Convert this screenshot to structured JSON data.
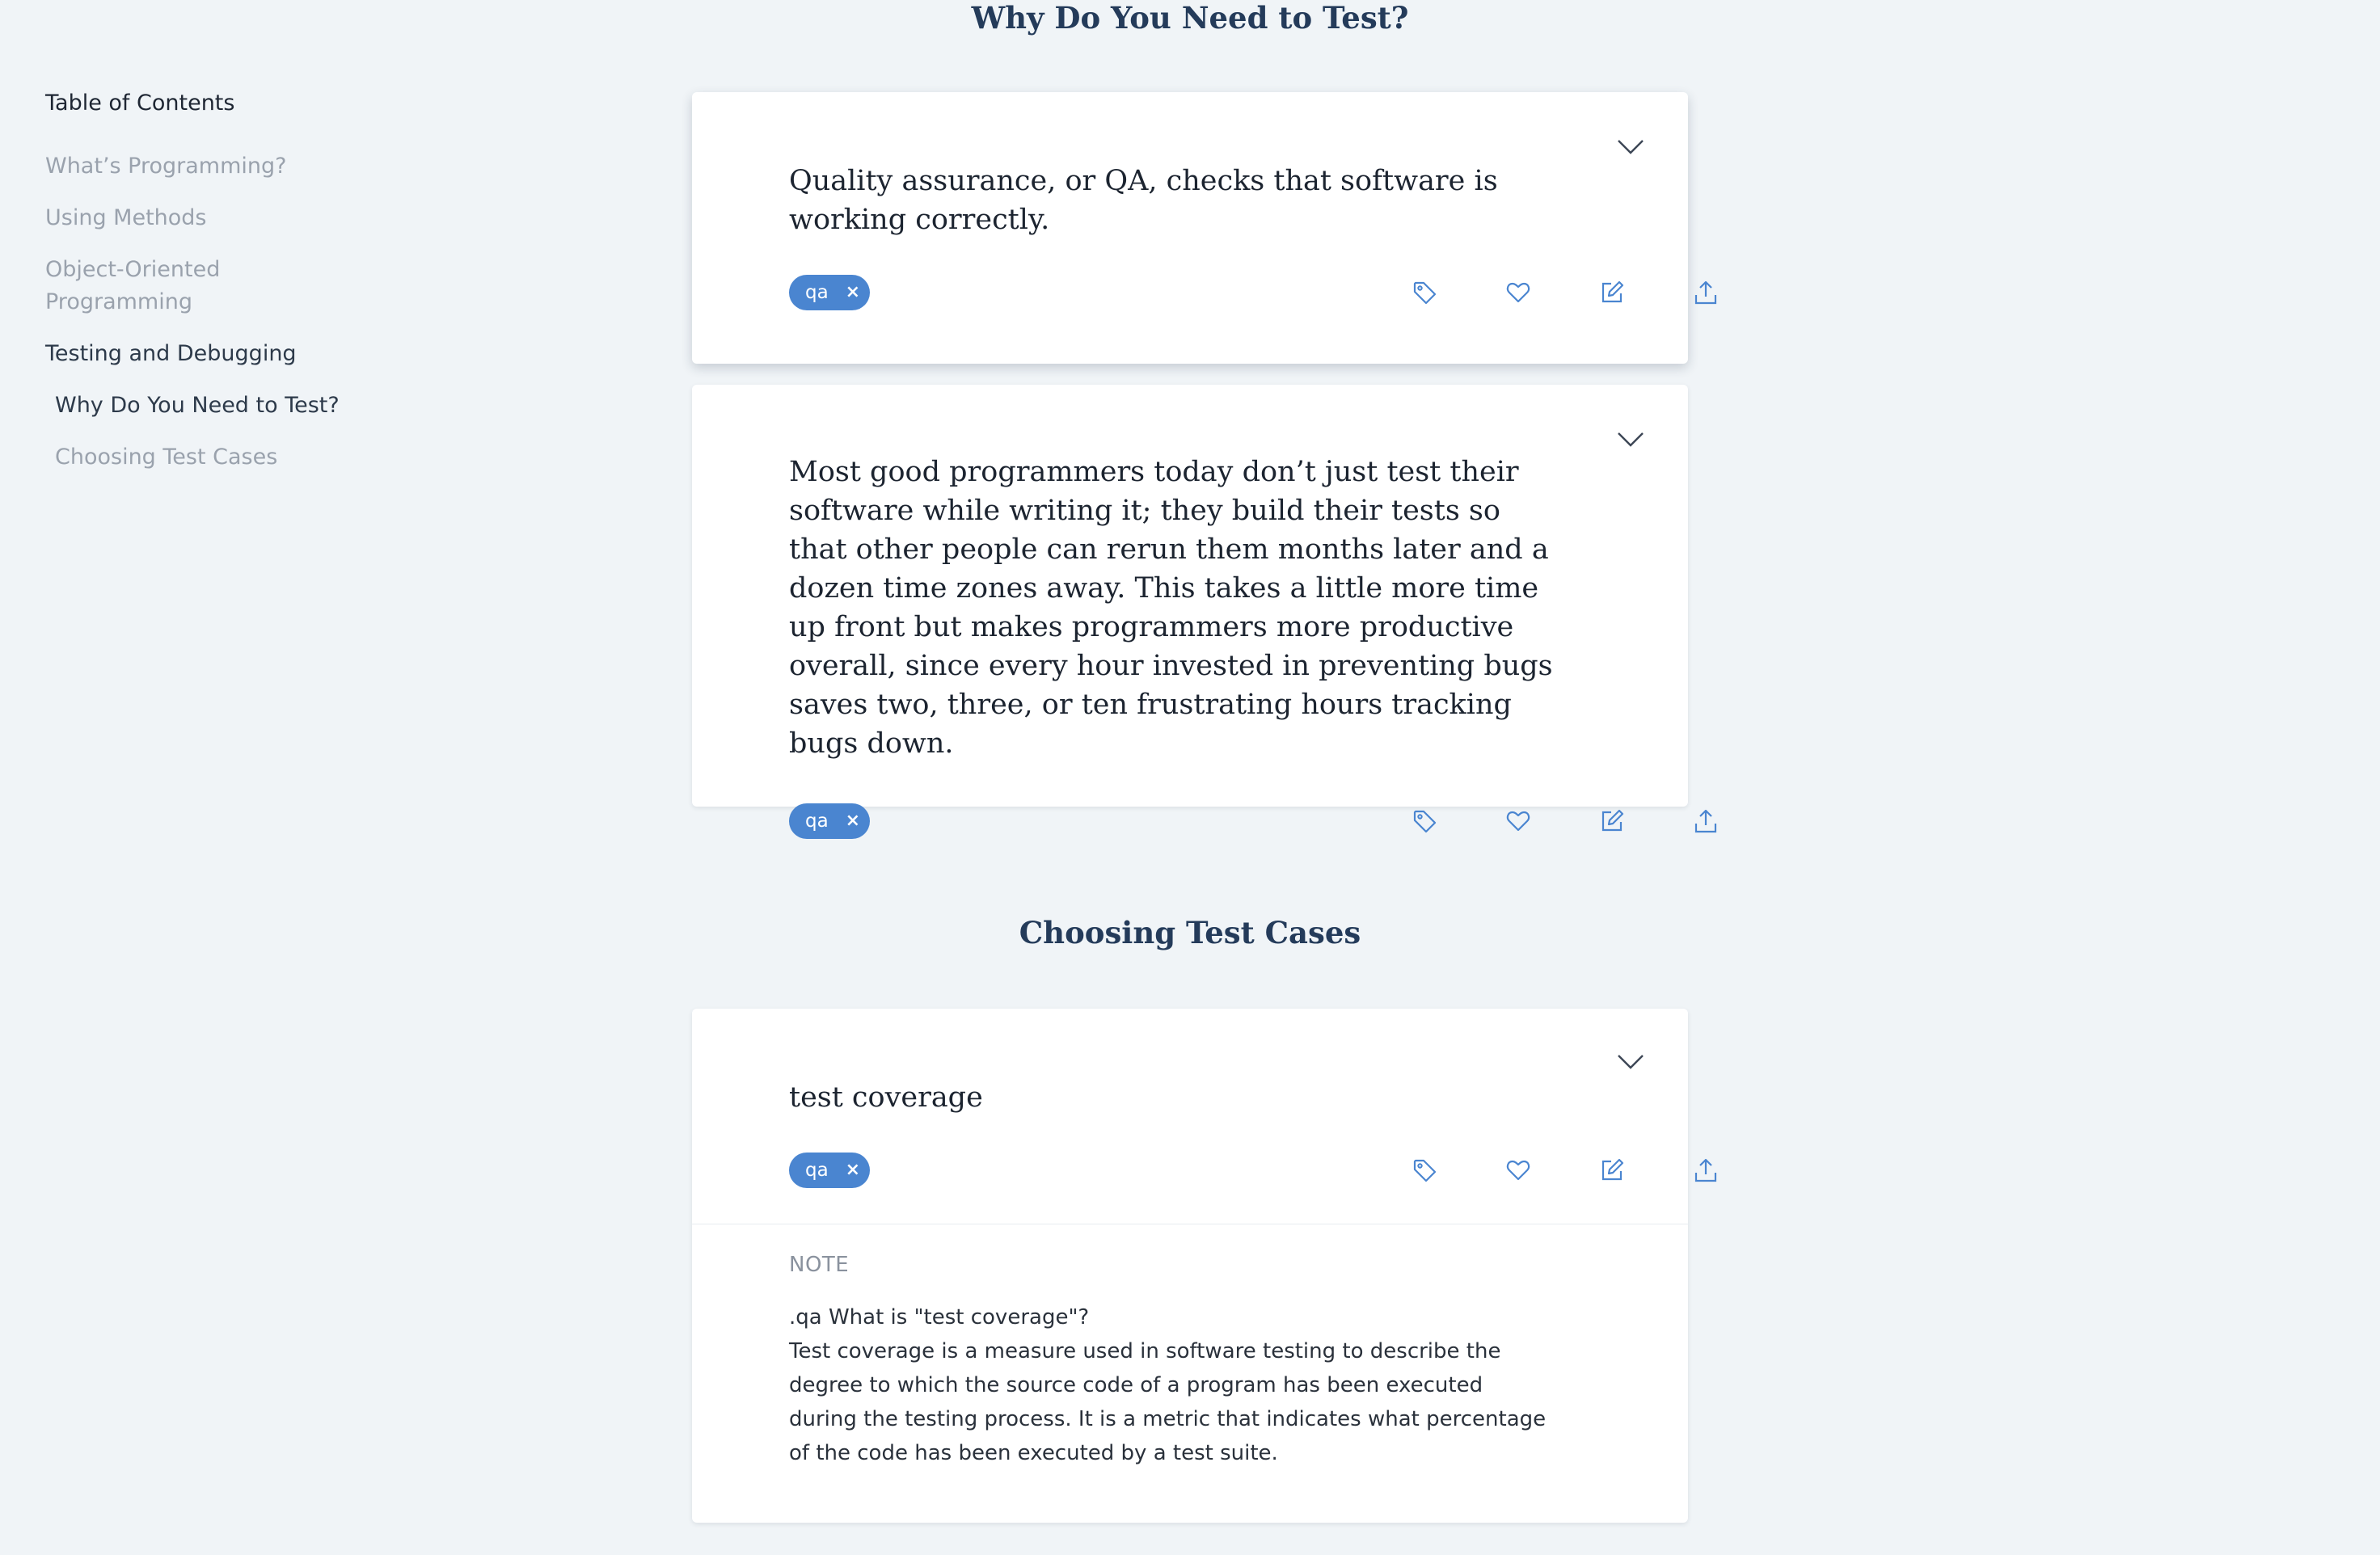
{
  "toc": {
    "title": "Table of Contents",
    "items": [
      {
        "label": "What’s Programming?"
      },
      {
        "label": "Using Methods"
      },
      {
        "label": "Object-Oriented Programming"
      },
      {
        "label": "Testing and Debugging"
      },
      {
        "label": "Why Do You Need to Test?"
      },
      {
        "label": "Choosing Test Cases"
      }
    ]
  },
  "sections": [
    {
      "heading": "Why Do You Need to Test?",
      "cards": [
        {
          "text": "Quality assurance, or QA, checks that software is working correctly.",
          "tag": "qa",
          "tag_remove": "×"
        },
        {
          "text": "Most good programmers today don’t just test their software while writing it; they build their tests so that other people can rerun them months later and a dozen time zones away. This takes a little more time up front but makes programmers more productive overall, since every hour invested in preventing bugs saves two, three, or ten frustrating hours tracking bugs down.",
          "tag": "qa",
          "tag_remove": "×"
        }
      ]
    },
    {
      "heading": "Choosing Test Cases",
      "cards": [
        {
          "text": "test coverage",
          "tag": "qa",
          "tag_remove": "×",
          "note_label": "NOTE",
          "note_question": ".qa What is \"test coverage\"?",
          "note_answer": "Test coverage is a measure used in software testing to describe the degree to which the source code of a program has been executed during the testing process. It is a metric that indicates what percentage of the code has been executed by a test suite."
        }
      ]
    }
  ],
  "icons": {
    "expand": "chevron-down-icon",
    "tag": "tag-icon",
    "favorite": "heart-icon",
    "edit": "edit-icon",
    "share": "share-icon"
  },
  "colors": {
    "background": "#f0f4f7",
    "accent": "#4a85d0",
    "heading": "#243b5a",
    "muted": "#9aa2ad"
  }
}
